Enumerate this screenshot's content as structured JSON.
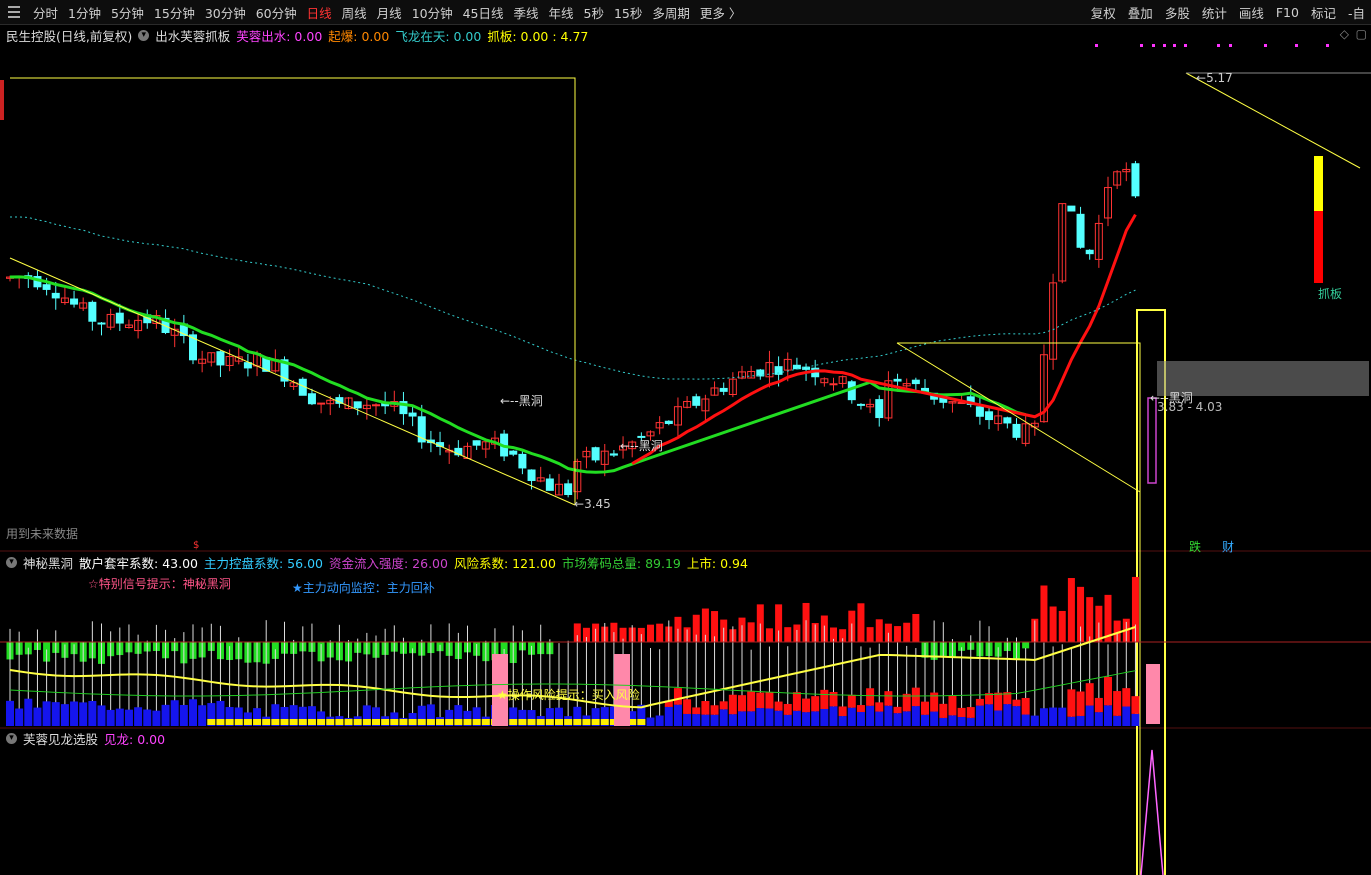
{
  "toolbar": {
    "periods": [
      "分时",
      "1分钟",
      "5分钟",
      "15分钟",
      "30分钟",
      "60分钟",
      "日线",
      "周线",
      "月线",
      "10分钟",
      "45日线",
      "季线",
      "年线",
      "5秒",
      "15秒",
      "多周期",
      "更多 〉"
    ],
    "active_period": "日线",
    "right_items": [
      "复权",
      "叠加",
      "多股",
      "统计",
      "画线",
      "F10",
      "标记",
      "-自"
    ]
  },
  "main_panel": {
    "stock_title": "民生控股(日线,前复权)",
    "indicator_name": "出水芙蓉抓板",
    "values": [
      {
        "label": "芙蓉出水: 0.00",
        "color": "#ff44ff"
      },
      {
        "label": "起爆: 0.00",
        "color": "#ff8800"
      },
      {
        "label": "飞龙在天: 0.00",
        "color": "#33cccc"
      },
      {
        "label": "抓板: 0.00 : 4.77",
        "color": "#ffff00"
      }
    ],
    "annotations": {
      "high_price": "5.17",
      "low_price": "3.45",
      "black_hole_1": "←--黑洞",
      "black_hole_2": "←--黑洞",
      "black_hole_3": "←--黑洞",
      "price_range": "3.83 - 4.03",
      "grab_board": "抓板",
      "future_data_note": "用到未来数据",
      "marker_die": "跌",
      "marker_cai": "财"
    }
  },
  "middle_panel": {
    "indicator_name": "神秘黑洞",
    "values": [
      {
        "label": "散户套牢系数: 43.00",
        "color": "#ffffff"
      },
      {
        "label": "主力控盘系数: 56.00",
        "color": "#33ccff"
      },
      {
        "label": "资金流入强度: 26.00",
        "color": "#cc44cc"
      },
      {
        "label": "风险系数: 121.00",
        "color": "#ffff00"
      },
      {
        "label": "市场筹码总量: 89.19",
        "color": "#33cc33"
      },
      {
        "label": "上市: 0.94",
        "color": "#ffff00"
      }
    ],
    "special_signal": "☆特别信号提示：",
    "special_signal_value": "神秘黑洞",
    "main_monitor": "★主力动向监控：",
    "main_monitor_value": "主力回补",
    "risk_hint": "★操作风险提示：买入风险"
  },
  "bottom_panel": {
    "indicator_name": "芙蓉见龙选股",
    "value": "见龙: 0.00"
  },
  "colors": {
    "up": "#ff3333",
    "down": "#54ffff",
    "ma_green": "#22dd22",
    "ma_red": "#ff1111",
    "yellow": "#ffff44"
  }
}
